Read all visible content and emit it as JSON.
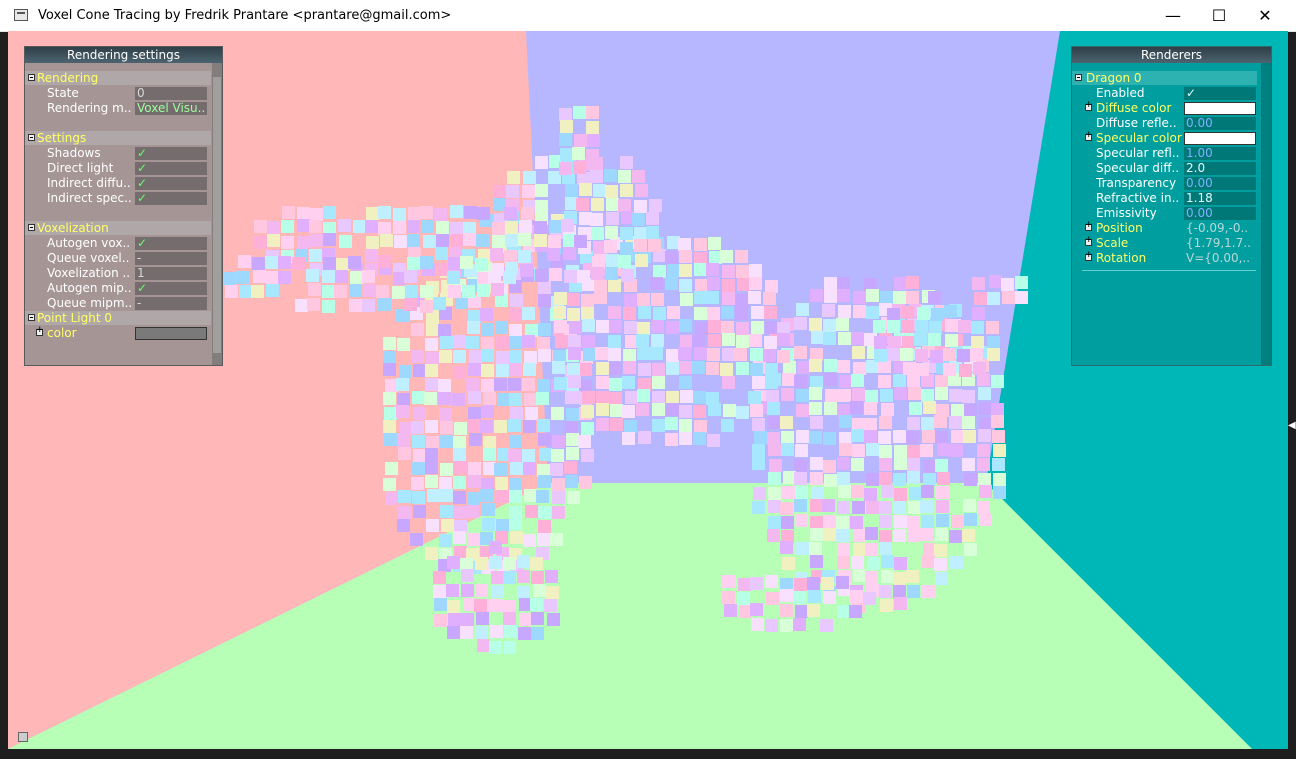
{
  "window": {
    "title": "Voxel Cone Tracing by Fredrik Prantare <prantare@gmail.com>",
    "minimize_glyph": "—",
    "maximize_glyph": "☐",
    "close_glyph": "✕"
  },
  "scene": {
    "left_wall_color": "#ffb7b7",
    "back_wall_color": "#b7b7ff",
    "right_wall_color": "#00b7b7",
    "floor_color": "#b7ffb7",
    "model": "voxelized-dragon"
  },
  "rendering_settings": {
    "title": "Rendering settings",
    "groups": [
      {
        "label": "Rendering",
        "rows": [
          {
            "label": "State",
            "value": "0"
          },
          {
            "label": "Rendering m..",
            "value": "Voxel Visu.."
          }
        ]
      },
      {
        "label": "Settings",
        "rows": [
          {
            "label": "Shadows",
            "value": "✓"
          },
          {
            "label": "Direct light",
            "value": "✓"
          },
          {
            "label": "Indirect diffu..",
            "value": "✓"
          },
          {
            "label": "Indirect spec..",
            "value": "✓"
          }
        ]
      },
      {
        "label": "Voxelization",
        "rows": [
          {
            "label": "Autogen vox..",
            "value": "✓"
          },
          {
            "label": "Queue voxel..",
            "value": "-"
          },
          {
            "label": "Voxelization ..",
            "value": "1"
          },
          {
            "label": "Autogen mip..",
            "value": "✓"
          },
          {
            "label": "Queue mipm..",
            "value": "-"
          }
        ]
      },
      {
        "label": "Point Light 0",
        "rows": [
          {
            "label": "color",
            "value": "",
            "swatch": "#7a7a7a"
          }
        ]
      }
    ]
  },
  "renderers": {
    "title": "Renderers",
    "group": "Dragon 0",
    "rows": [
      {
        "label": "Enabled",
        "value": "✓"
      },
      {
        "label": "Diffuse color",
        "value": "",
        "swatch": "#ffffff"
      },
      {
        "label": "Diffuse refle..",
        "value": "0.00"
      },
      {
        "label": "Specular color",
        "value": "",
        "swatch": "#ffffff"
      },
      {
        "label": "Specular refl..",
        "value": "1.00"
      },
      {
        "label": "Specular diff..",
        "value": "2.0"
      },
      {
        "label": "Transparency",
        "value": "0.00"
      },
      {
        "label": "Refractive in..",
        "value": "1.18"
      },
      {
        "label": "Emissivity",
        "value": "0.00"
      },
      {
        "label": "Position",
        "value": "{-0.09,-0.."
      },
      {
        "label": "Scale",
        "value": "{1.79,1.7.."
      },
      {
        "label": "Rotation",
        "value": "V={0.00,.."
      }
    ]
  },
  "colors": {
    "group_label": "#ffff66",
    "checkmark": "#66ff66",
    "panel_title_bg": "#3c4f5a"
  }
}
